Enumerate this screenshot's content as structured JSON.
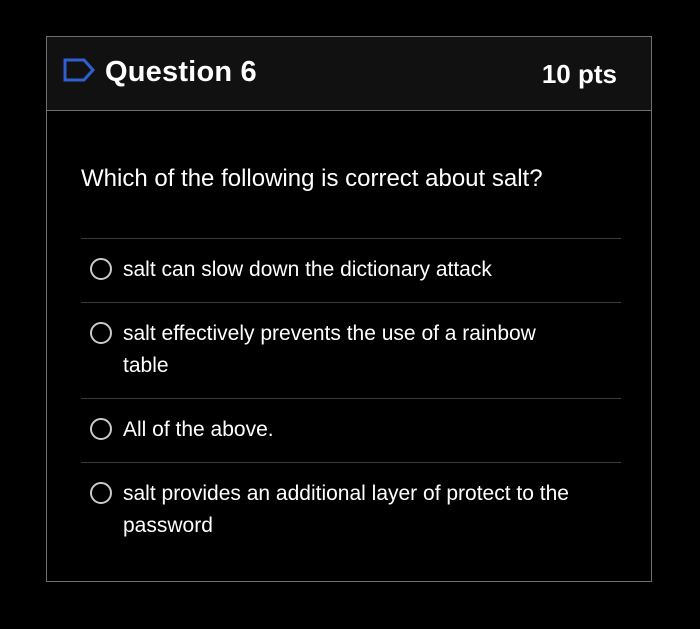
{
  "question": {
    "icon": "flag-outline-icon",
    "title": "Question 6",
    "points": "10 pts",
    "text": "Which of the following is correct about salt?",
    "accent_color": "#2f5fd0",
    "answers": [
      {
        "label": "salt can slow down the dictionary attack",
        "selected": false
      },
      {
        "label": "salt effectively prevents the use of a rainbow table",
        "selected": false
      },
      {
        "label": "All of the above.",
        "selected": false
      },
      {
        "label": "salt provides an additional layer of protect to the password",
        "selected": false
      }
    ]
  }
}
